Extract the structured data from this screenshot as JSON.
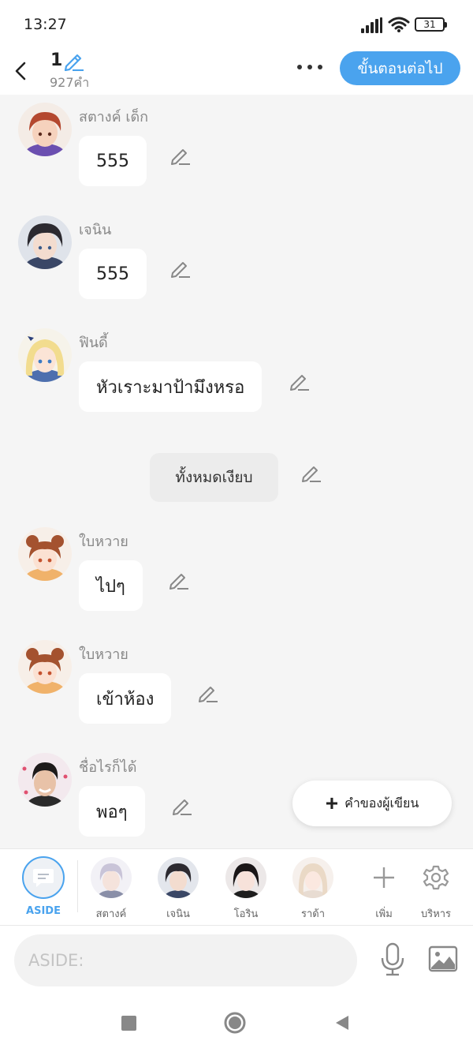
{
  "status_bar": {
    "time": "13:27",
    "battery": "31"
  },
  "header": {
    "title": "1",
    "word_count": "927คำ",
    "next_button": "ขั้นตอนต่อไป"
  },
  "messages": [
    {
      "sender": "สตางค์ เด็ก",
      "text": "555",
      "avatar": "boy-red-hair-avatar"
    },
    {
      "sender": "เจนิน",
      "text": "555",
      "avatar": "boy-dark-hair-avatar"
    },
    {
      "sender": "ฟินดี้",
      "text": "หัวเราะมาป้ามึงหรอ",
      "avatar": "girl-blonde-avatar"
    },
    {
      "narration": "ทั้งหมดเงียบ"
    },
    {
      "sender": "ใบหวาย",
      "text": "ไปๆ",
      "avatar": "girl-brown-buns-avatar"
    },
    {
      "sender": "ใบหวาย",
      "text": "เข้าห้อง",
      "avatar": "girl-brown-buns-avatar"
    },
    {
      "sender": "ชื่อไรก็ได้",
      "text": "พอๆ",
      "avatar": "photo-boy-avatar"
    }
  ],
  "author_note_button": "คำของผู้เขียน",
  "character_bar": {
    "aside_label": "ASIDE",
    "characters": [
      "สตางค์",
      "เจนิน",
      "โอริน",
      "ราด้า"
    ],
    "add_label": "เพิ่ม",
    "manage_label": "บริหาร"
  },
  "input": {
    "placeholder": "ASIDE:"
  },
  "colors": {
    "accent": "#4aa3ee",
    "chat_bg": "#f5f5f5"
  }
}
